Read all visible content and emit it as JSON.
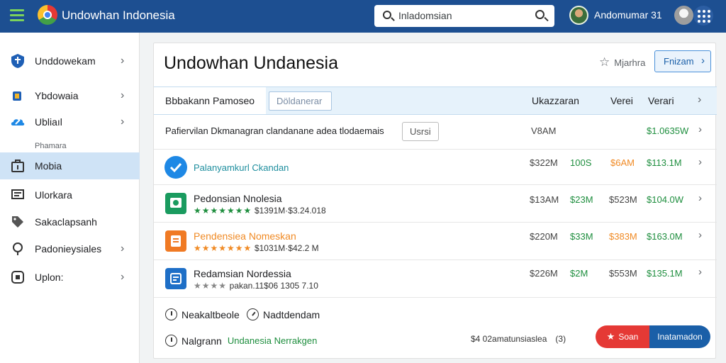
{
  "app": {
    "title": "Undowhan Indonesia",
    "search_value": "Inladomsian",
    "user_name": "Andomumar 31"
  },
  "sidebar": {
    "section_label": "Phamara",
    "items": [
      {
        "label": "Unddowekam",
        "icon": "shield-icon",
        "chevron": true
      },
      {
        "label": "Ybdowaia",
        "icon": "chip-icon",
        "chevron": true
      },
      {
        "label": "Ubliaıl",
        "icon": "cloud-icon",
        "chevron": true
      },
      {
        "label": "Mobia",
        "icon": "bag-icon",
        "chevron": false,
        "active": true
      },
      {
        "label": "Ulorkara",
        "icon": "monitor-icon",
        "chevron": false
      },
      {
        "label": "Sakaclapsanh",
        "icon": "tag-icon",
        "chevron": false
      },
      {
        "label": "Padonieysiales",
        "icon": "pin-icon",
        "chevron": true
      },
      {
        "label": "Uplon:",
        "icon": "square-icon",
        "chevron": true
      }
    ]
  },
  "main": {
    "page_title": "Undowhan Undanesia",
    "star_label": "Mjarhra",
    "primary_button": "Fnizam",
    "tabs": {
      "active": "Bbbakann Pamoseo",
      "secondary": "Döldanerar"
    },
    "headers": [
      "Ukazzaran",
      "Verei",
      "Verari"
    ],
    "rows": [
      {
        "title": "Pafiervilan Dkmanagran clandanane adea tlodaemais",
        "badge": "Usrsi",
        "c1": "V8AM",
        "c2": "",
        "c3": "",
        "c4": "$1.0635W"
      },
      {
        "title": "Palanyamkurl Ckandan",
        "c1": "$322M",
        "c2": "100S",
        "c3": "$6AM",
        "c4": "$113.1M"
      },
      {
        "title": "Pedonsian Nnolesia",
        "sub": "$1391M·$3.24.018",
        "stars": "★★★★★★★",
        "c1": "$13AM",
        "c2": "$23M",
        "c3": "$523M",
        "c4": "$104.0W"
      },
      {
        "title": "Pendensiea Nomeskan",
        "sub": "$1031M·$42.2 M",
        "stars": "★★★★★★★",
        "c1": "$220M",
        "c2": "$33M",
        "c3": "$383M",
        "c4": "$163.0M"
      },
      {
        "title": "Redamsian Nordessia",
        "sub": "pakan.11$06 1305 7.10",
        "stars": "★★★★",
        "c1": "$226M",
        "c2": "$2M",
        "c3": "$553M",
        "c4": "$135.1M"
      }
    ],
    "footer": {
      "left1": "Neakaltbeole",
      "left2": "Nadtdendam",
      "left3_a": "Nalgrann",
      "left3_b": "Undanesia Nerrakgen",
      "stats": "$4 02amatunsiaslea",
      "stats_count": "(3)",
      "split_left": "Soan",
      "split_right": "Inatamadon"
    }
  }
}
